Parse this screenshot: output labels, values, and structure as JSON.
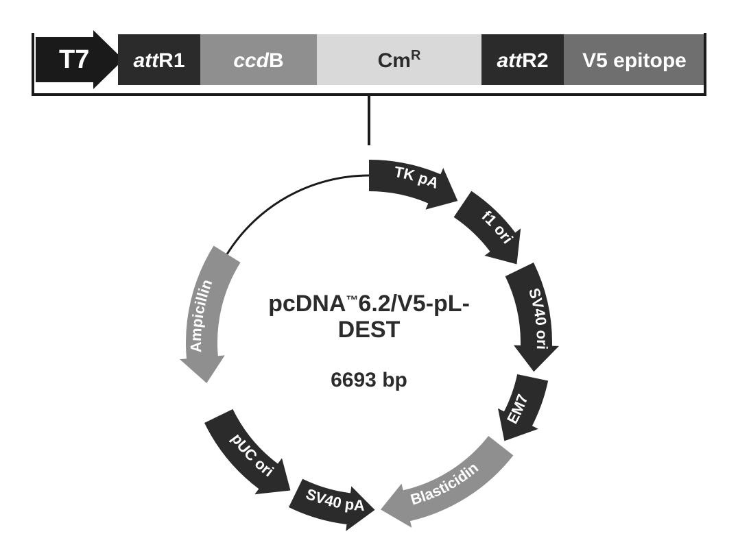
{
  "promoter": {
    "label": "T7"
  },
  "cassette": {
    "segments": [
      {
        "id": "attR1",
        "plain": "R1",
        "italic": "att",
        "bg": "#2b2b2b",
        "fg": "white"
      },
      {
        "id": "ccdB",
        "plain": "B",
        "italic": "ccd",
        "bg": "#8f8f8f",
        "fg": "white"
      },
      {
        "id": "CmR",
        "plain": "Cm",
        "sup": "R",
        "bg": "#d9d9d9",
        "fg": "dark"
      },
      {
        "id": "attR2",
        "plain": "R2",
        "italic": "att",
        "bg": "#2b2b2b",
        "fg": "white"
      },
      {
        "id": "V5",
        "plain": "V5 epitope",
        "bg": "#6f6f6f",
        "fg": "white"
      }
    ]
  },
  "plasmid": {
    "name_line1_a": "pcDNA",
    "name_line1_tm": "™",
    "name_line1_b": "6.2/V5-pL-",
    "name_line2": "DEST",
    "size": "6693 bp",
    "features": [
      {
        "id": "TKpA",
        "label": "TK pA",
        "color": "#2b2b2b"
      },
      {
        "id": "f1ori",
        "label": "f1 ori",
        "color": "#2b2b2b"
      },
      {
        "id": "SV40ori",
        "label": "SV40 ori",
        "color": "#2b2b2b"
      },
      {
        "id": "EM7",
        "label": "EM7",
        "color": "#2b2b2b"
      },
      {
        "id": "Blasticidin",
        "label": "Blasticidin",
        "color": "#8f8f8f"
      },
      {
        "id": "SV40pA",
        "label": "SV40 pA",
        "color": "#2b2b2b"
      },
      {
        "id": "pUCori",
        "label": "pUC ori",
        "color": "#2b2b2b"
      },
      {
        "id": "Ampicillin",
        "label": "Ampicillin",
        "color": "#8f8f8f"
      }
    ]
  }
}
